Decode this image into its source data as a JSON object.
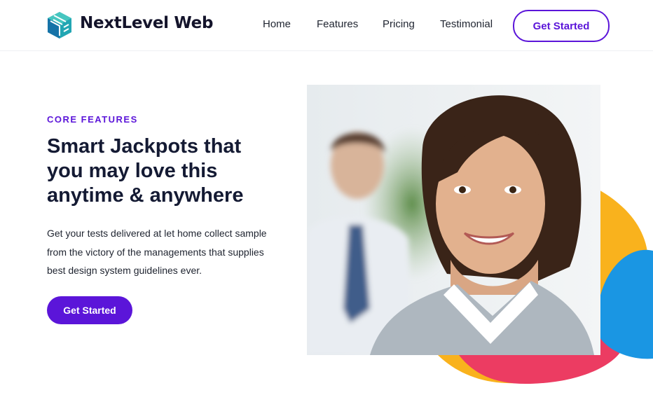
{
  "brand": {
    "name": "NextLevel Web",
    "logo": "cube-logo-icon"
  },
  "nav": {
    "items": [
      "Home",
      "Features",
      "Pricing",
      "Testimonial"
    ],
    "cta_label": "Get Started"
  },
  "hero": {
    "eyebrow": "CORE FEATURES",
    "headline": "Smart Jackpots that you may love this anytime & anywhere",
    "description": "Get your tests delivered at let home collect sample from the victory of the managements that supplies best design system guidelines ever.",
    "button_label": "Get Started",
    "image": "smiling-woman-photo"
  },
  "colors": {
    "accent": "#5b15d9",
    "heading": "#141a33",
    "shape_yellow": "#f9b21d",
    "shape_red": "#ec3c62",
    "shape_blue": "#1a96e3"
  }
}
